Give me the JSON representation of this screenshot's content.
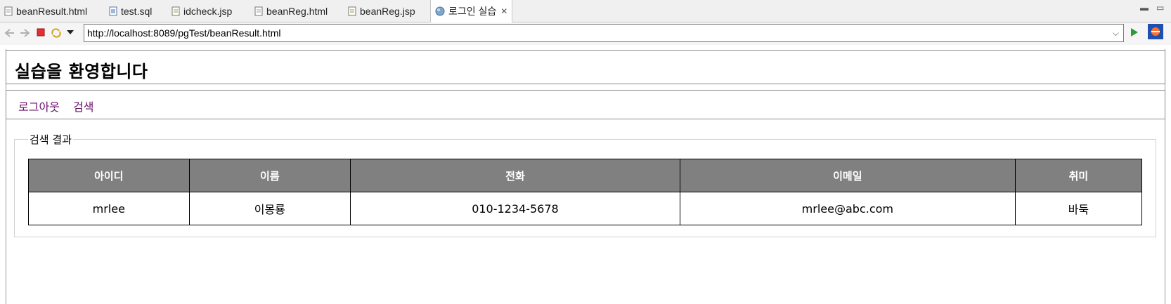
{
  "tabs": [
    {
      "label": "beanResult.html",
      "icon": "html-file-icon"
    },
    {
      "label": "test.sql",
      "icon": "sql-file-icon"
    },
    {
      "label": "idcheck.jsp",
      "icon": "jsp-file-icon"
    },
    {
      "label": "beanReg.html",
      "icon": "html-file-icon"
    },
    {
      "label": "beanReg.jsp",
      "icon": "jsp-file-icon"
    },
    {
      "label": "로그인 실습",
      "icon": "globe-icon",
      "active": true
    }
  ],
  "browser": {
    "url": "http://localhost:8089/pgTest/beanResult.html"
  },
  "page": {
    "title": "실습을 환영합니다",
    "menu": [
      "로그아웃",
      "검색"
    ],
    "legend": "검색 결과",
    "table": {
      "headers": [
        "아이디",
        "이름",
        "전화",
        "이메일",
        "취미"
      ],
      "rows": [
        [
          "mrlee",
          "이몽룡",
          "010-1234-5678",
          "mrlee@abc.com",
          "바둑"
        ]
      ]
    }
  },
  "colors": {
    "header_bg": "#808080",
    "link": "#6a0f6a"
  }
}
